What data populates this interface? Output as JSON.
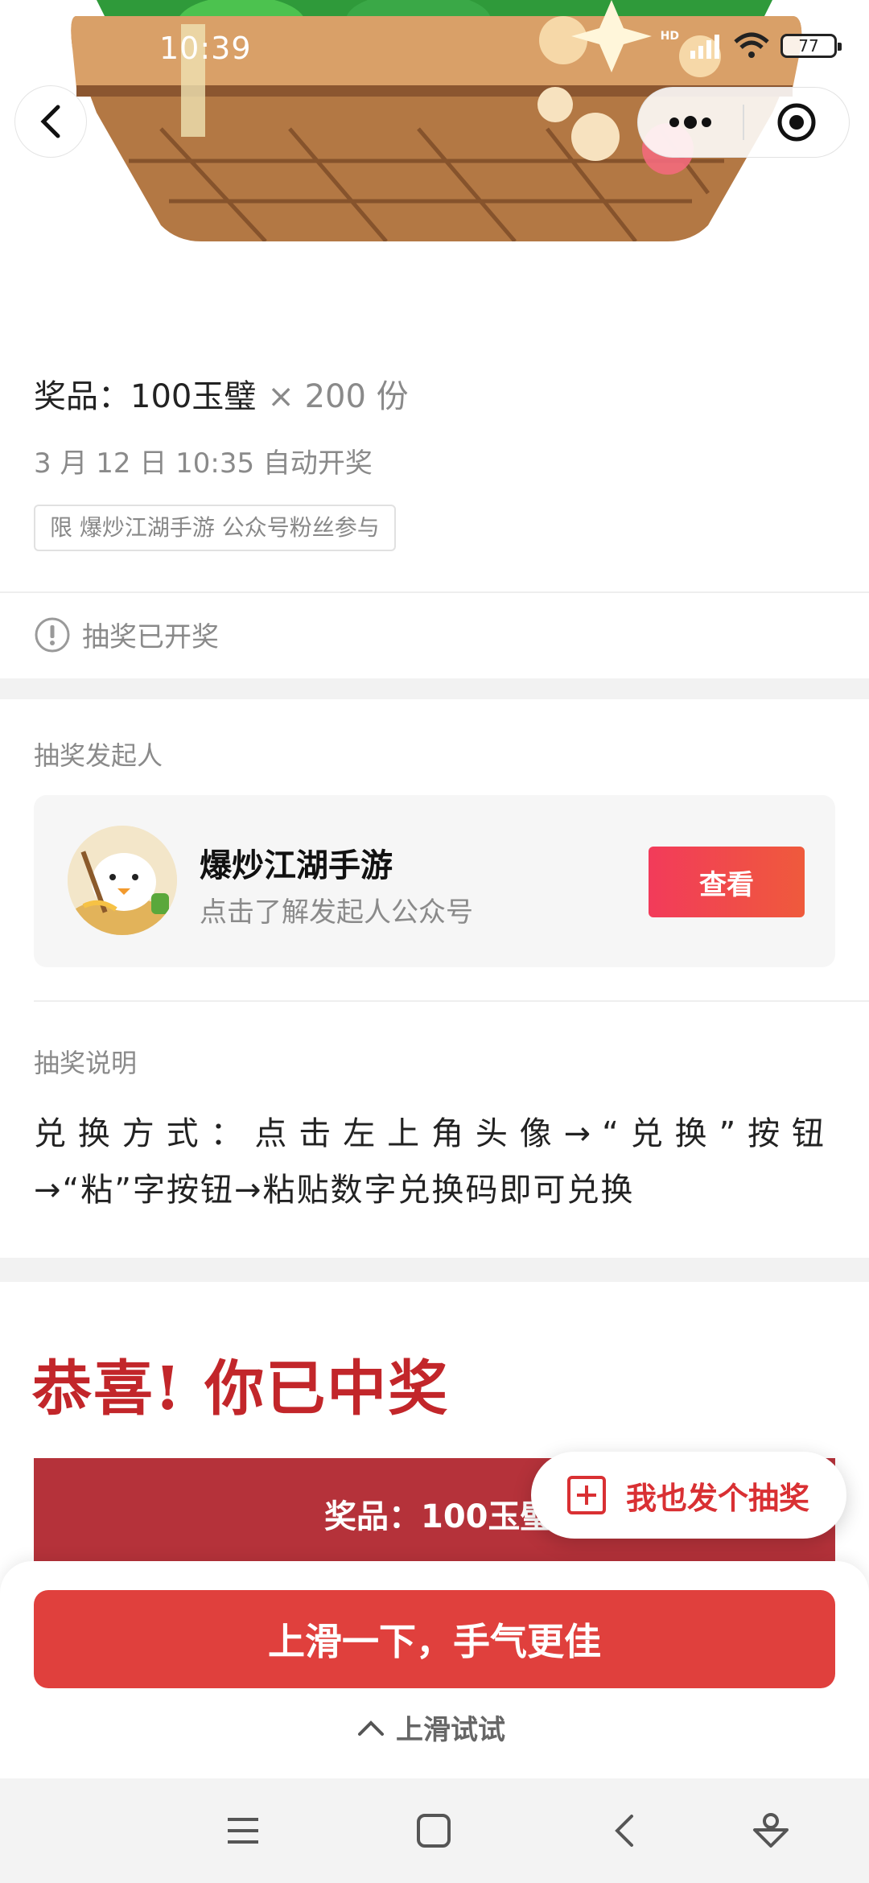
{
  "status_bar": {
    "time": "10:39",
    "network": "HD",
    "battery": "77"
  },
  "prize": {
    "title": "奖品：100玉璧",
    "quantity": "× 200 份",
    "draw_time": "3 月 12 日 10:35 自动开奖",
    "limit": "限 爆炒江湖手游 公众号粉丝参与"
  },
  "status": {
    "text": "抽奖已开奖"
  },
  "sponsor": {
    "section_label": "抽奖发起人",
    "name": "爆炒江湖手游",
    "subtitle": "点击了解发起人公众号",
    "view_button": "查看"
  },
  "description": {
    "section_label": "抽奖说明",
    "line1": "兑换方式：点击左上角头像→“兑换”按钮",
    "line2": "→“粘”字按钮→粘贴数字兑换码即可兑换"
  },
  "result": {
    "title": "恭喜! 你已中奖",
    "prize_banner": "奖品：100玉璧"
  },
  "float_button": {
    "label": "我也发个抽奖"
  },
  "bottom": {
    "swipe_button": "上滑一下，手气更佳",
    "hint": "上滑试试"
  },
  "colors": {
    "accent_red": "#e0403d",
    "title_red": "#c2262a",
    "banner_red": "#b5323a"
  }
}
